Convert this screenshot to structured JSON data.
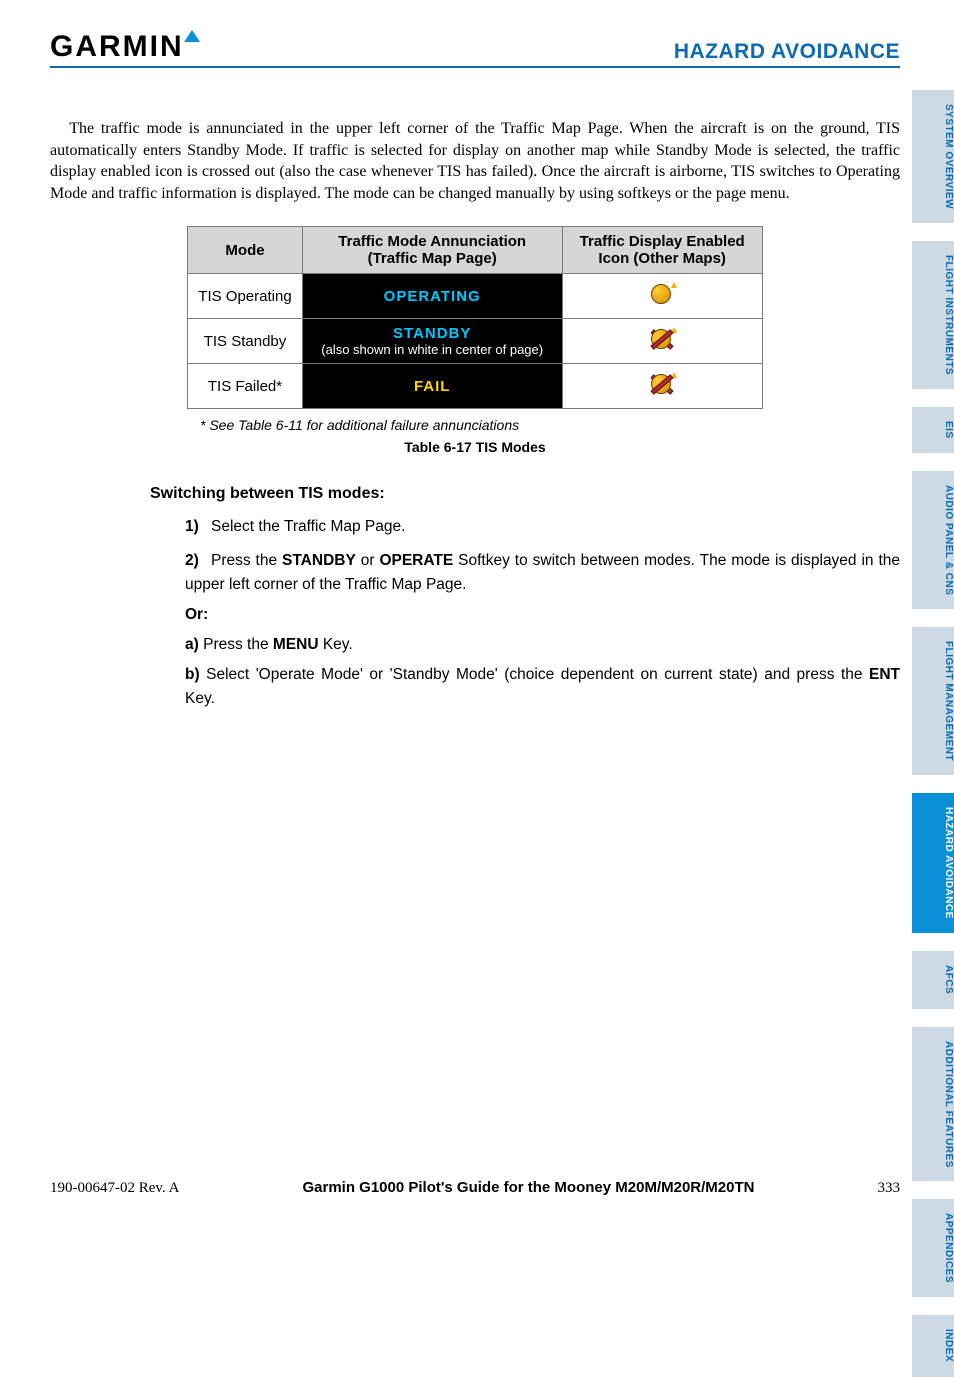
{
  "header": {
    "brand_text": "GARMIN",
    "section_title": "HAZARD AVOIDANCE"
  },
  "paragraph": "The traffic mode is annunciated in the upper left corner of the Traffic Map Page.  When the aircraft is on the ground, TIS automatically enters Standby Mode. If traffic is selected for display on another map while Standby Mode is selected, the traffic display enabled icon is crossed out (also the case whenever TIS has failed).  Once the aircraft is airborne, TIS switches to Operating Mode and traffic information is displayed.  The mode can be changed manually by using softkeys or the page menu.",
  "table": {
    "headers": {
      "mode": "Mode",
      "annunciation": "Traffic Mode Annunciation (Traffic Map Page)",
      "icon": "Traffic Display Enabled Icon (Other Maps)"
    },
    "rows": [
      {
        "mode": "TIS Operating",
        "ann": "OPERATING",
        "sub": ""
      },
      {
        "mode": "TIS Standby",
        "ann": "STANDBY",
        "sub": "(also shown in white in center of page)"
      },
      {
        "mode": "TIS Failed*",
        "ann": "FAIL",
        "sub": ""
      }
    ]
  },
  "footnote": "* See Table 6-11 for additional failure annunciations",
  "table_caption": "Table 6-17  TIS Modes",
  "procedure": {
    "heading": "Switching between TIS modes:",
    "step1_num": "1)",
    "step1": "Select the Traffic Map Page.",
    "step2_num": "2)",
    "step2_pre": "Press the ",
    "step2_b1": "STANDBY",
    "step2_mid": " or ",
    "step2_b2": "OPERATE",
    "step2_post": " Softkey to switch between modes.  The mode is displayed in the upper left corner of the Traffic Map Page.",
    "or": "Or",
    "a_lbl": "a)",
    "a_pre": " Press the ",
    "a_b": "MENU",
    "a_post": " Key.",
    "b_lbl": "b)",
    "b_pre": " Select 'Operate Mode' or 'Standby Mode' (choice dependent on current state) and press the ",
    "b_b": "ENT",
    "b_post": " Key."
  },
  "footer": {
    "docnum": "190-00647-02  Rev. A",
    "title": "Garmin G1000 Pilot's Guide for the Mooney M20M/M20R/M20TN",
    "page": "333"
  },
  "tabs": [
    {
      "label": "SYSTEM OVERVIEW",
      "active": false
    },
    {
      "label": "FLIGHT INSTRUMENTS",
      "active": false
    },
    {
      "label": "EIS",
      "active": false
    },
    {
      "label": "AUDIO PANEL & CNS",
      "active": false
    },
    {
      "label": "FLIGHT MANAGEMENT",
      "active": false
    },
    {
      "label": "HAZARD AVOIDANCE",
      "active": true
    },
    {
      "label": "AFCS",
      "active": false
    },
    {
      "label": "ADDITIONAL FEATURES",
      "active": false
    },
    {
      "label": "APPENDICES",
      "active": false
    },
    {
      "label": "INDEX",
      "active": false
    }
  ]
}
